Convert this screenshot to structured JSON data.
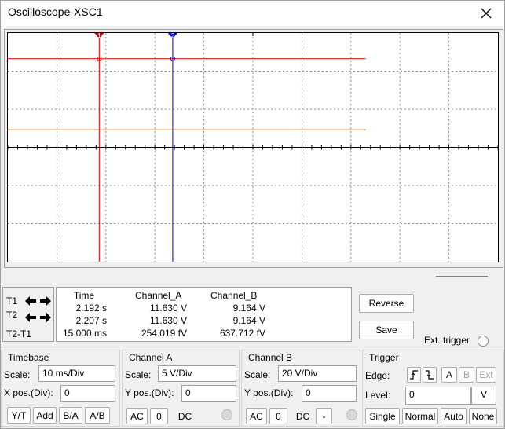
{
  "window": {
    "title": "Oscilloscope-XSC1"
  },
  "colors": {
    "cursor1": "#cc0000",
    "cursor2": "#0000cc",
    "channel_a": "#dd2222",
    "channel_b": "#e07a10",
    "grid": "#888888"
  },
  "cursors": {
    "t1_label": "T1",
    "t2_label": "T2",
    "diff_label": "T2-T1",
    "marker1": "1",
    "marker2": "2"
  },
  "readout": {
    "headers": {
      "time": "Time",
      "ch_a": "Channel_A",
      "ch_b": "Channel_B"
    },
    "rows": [
      {
        "time": "2.192 s",
        "ch_a": "11.630 V",
        "ch_b": "9.164 V"
      },
      {
        "time": "2.207 s",
        "ch_a": "11.630 V",
        "ch_b": "9.164 V"
      },
      {
        "time": "15.000 ms",
        "ch_a": "254.019 fV",
        "ch_b": "637.712 fV"
      }
    ]
  },
  "buttons": {
    "reverse": "Reverse",
    "save": "Save",
    "ext_trigger": "Ext. trigger"
  },
  "timebase": {
    "title": "Timebase",
    "scale_label": "Scale:",
    "scale": "10 ms/Div",
    "xpos_label": "X pos.(Div):",
    "xpos": "0",
    "modes": [
      "Y/T",
      "Add",
      "B/A",
      "A/B"
    ]
  },
  "channel_a": {
    "title": "Channel A",
    "scale_label": "Scale:",
    "scale": "5  V/Div",
    "ypos_label": "Y pos.(Div):",
    "ypos": "0",
    "coupling": [
      "AC",
      "0",
      "DC"
    ]
  },
  "channel_b": {
    "title": "Channel B",
    "scale_label": "Scale:",
    "scale": "20  V/Div",
    "ypos_label": "Y pos.(Div):",
    "ypos": "0",
    "coupling": [
      "AC",
      "0",
      "DC",
      "-"
    ]
  },
  "trigger": {
    "title": "Trigger",
    "edge_label": "Edge:",
    "edge_sources": [
      "A",
      "B",
      "Ext"
    ],
    "level_label": "Level:",
    "level": "0",
    "level_unit": "V",
    "modes": [
      "Single",
      "Normal",
      "Auto",
      "None"
    ]
  }
}
